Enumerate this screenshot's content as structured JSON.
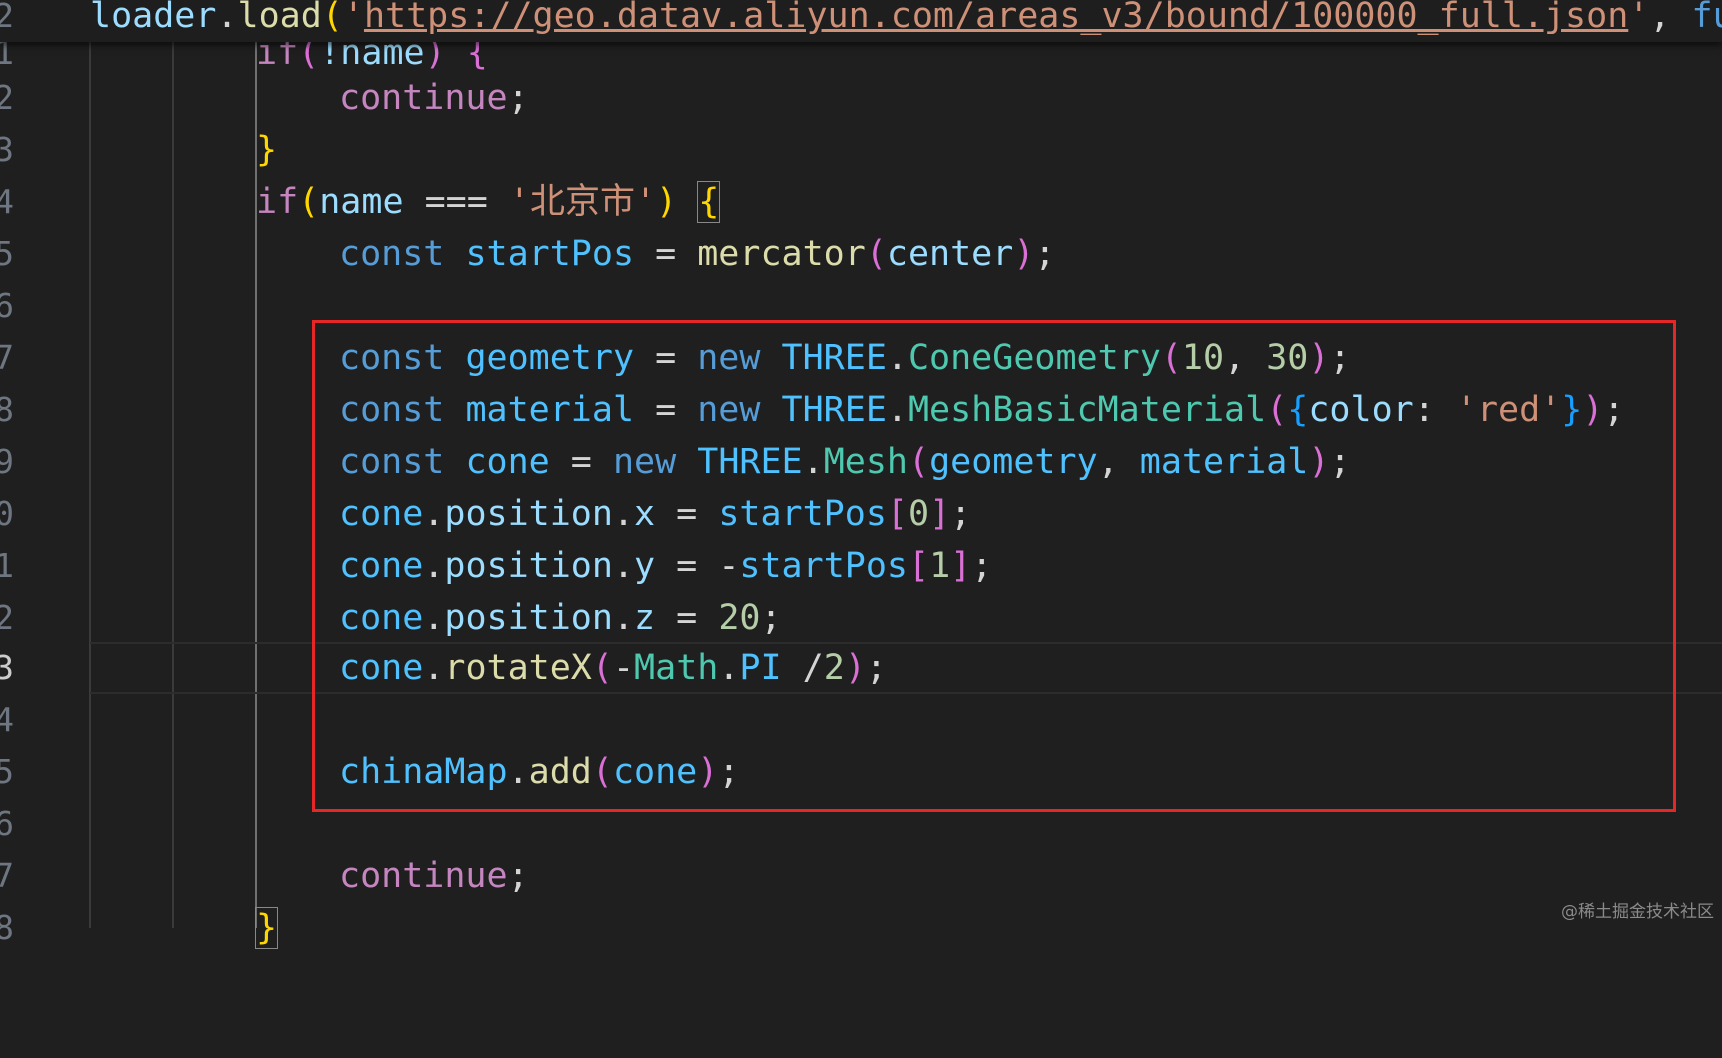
{
  "gutter": [
    "2",
    "1",
    "2",
    "3",
    "4",
    "5",
    "6",
    "7",
    "8",
    "9",
    "0",
    "1",
    "2",
    "3",
    "4",
    "5",
    "6",
    "7",
    "8"
  ],
  "sticky": {
    "p1": "loader",
    "p2": ".",
    "p3": "load",
    "p4": "(",
    "p5": "'",
    "url": "https://geo.datav.aliyun.com/areas_v3/bound/100000_full.json",
    "p6": "'",
    "p7": ", ",
    "p8": "fun"
  },
  "code": {
    "l1": {
      "a": "if",
      "b": "(",
      "c": "!name",
      "d": ") {"
    },
    "l2": {
      "a": "continue",
      "b": ";"
    },
    "l3": {
      "a": "}"
    },
    "l4": {
      "a": "if",
      "b": "(",
      "c": "name",
      "d": " === ",
      "e": "'北京市'",
      "f": ")",
      "g": " ",
      "h": "{"
    },
    "l5": {
      "a": "const",
      "b": " ",
      "c": "startPos",
      "d": " = ",
      "e": "mercator",
      "f": "(",
      "g": "center",
      "h": ")",
      "i": ";"
    },
    "l7": {
      "a": "const",
      "b": " ",
      "c": "geometry",
      "d": " = ",
      "e": "new",
      "f": " ",
      "g": "THREE",
      "h": ".",
      "i": "ConeGeometry",
      "j": "(",
      "k": "10",
      "l": ", ",
      "m": "30",
      "n": ")",
      "o": ";"
    },
    "l8": {
      "a": "const",
      "b": " ",
      "c": "material",
      "d": " = ",
      "e": "new",
      "f": " ",
      "g": "THREE",
      "h": ".",
      "i": "MeshBasicMaterial",
      "j": "(",
      "k": "{",
      "l": "color",
      "m": ": ",
      "n": "'red'",
      "o": "}",
      "p": ")",
      "q": ";"
    },
    "l9": {
      "a": "const",
      "b": " ",
      "c": "cone",
      "d": " = ",
      "e": "new",
      "f": " ",
      "g": "THREE",
      "h": ".",
      "i": "Mesh",
      "j": "(",
      "k": "geometry",
      "l": ", ",
      "m": "material",
      "n": ")",
      "o": ";"
    },
    "l10": {
      "a": "cone",
      "b": ".",
      "c": "position",
      "d": ".",
      "e": "x",
      "f": " = ",
      "g": "startPos",
      "h": "[",
      "i": "0",
      "j": "]",
      "k": ";"
    },
    "l11": {
      "a": "cone",
      "b": ".",
      "c": "position",
      "d": ".",
      "e": "y",
      "f": " = -",
      "g": "startPos",
      "h": "[",
      "i": "1",
      "j": "]",
      "k": ";"
    },
    "l12": {
      "a": "cone",
      "b": ".",
      "c": "position",
      "d": ".",
      "e": "z",
      "f": " = ",
      "g": "20",
      "h": ";"
    },
    "l13": {
      "a": "cone",
      "b": ".",
      "c": "rotateX",
      "d": "(",
      "e": "-",
      "f": "Math",
      "g": ".",
      "h": "PI",
      "i": " /",
      "j": "2",
      "k": ")",
      "l": ";"
    },
    "l15": {
      "a": "chinaMap",
      "b": ".",
      "c": "add",
      "d": "(",
      "e": "cone",
      "f": ")",
      "g": ";"
    },
    "l17": {
      "a": "continue",
      "b": ";"
    },
    "l18": {
      "a": "}"
    }
  },
  "watermark": "@稀土掘金技术社区",
  "colors": {
    "background": "#1f1f1f",
    "highlight_box": "#e62727",
    "keyword": "#c586c0",
    "declaration": "#569cd6",
    "variable": "#9cdcfe",
    "function": "#dcdcaa",
    "class": "#4ec9b0",
    "string": "#ce9178",
    "number": "#b5cea8"
  }
}
